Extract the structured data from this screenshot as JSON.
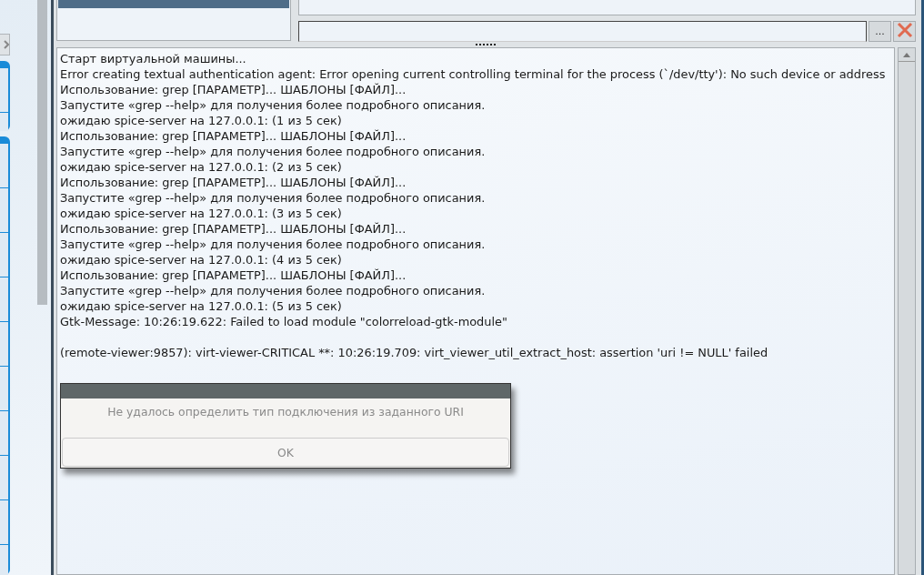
{
  "log": {
    "blocks": [
      [
        "Старт виртуальной машины...",
        "Error creating textual authentication agent: Error opening current controlling terminal for the process (`/dev/tty'): No such device or address",
        "Использование: grep [ПАРАМЕТР]... ШАБЛОНЫ [ФАЙЛ]...",
        "Запустите «grep --help» для получения более подробного описания.",
        "ожидаю spice-server на 127.0.0.1: (1 из 5 сек)",
        "Использование: grep [ПАРАМЕТР]... ШАБЛОНЫ [ФАЙЛ]...",
        "Запустите «grep --help» для получения более подробного описания.",
        "ожидаю spice-server на 127.0.0.1: (2 из 5 сек)",
        "Использование: grep [ПАРАМЕТР]... ШАБЛОНЫ [ФАЙЛ]...",
        "Запустите «grep --help» для получения более подробного описания.",
        "ожидаю spice-server на 127.0.0.1: (3 из 5 сек)",
        "Использование: grep [ПАРАМЕТР]... ШАБЛОНЫ [ФАЙЛ]...",
        "Запустите «grep --help» для получения более подробного описания.",
        "ожидаю spice-server на 127.0.0.1: (4 из 5 сек)",
        "Использование: grep [ПАРАМЕТР]... ШАБЛОНЫ [ФАЙЛ]...",
        "Запустите «grep --help» для получения более подробного описания.",
        "ожидаю spice-server на 127.0.0.1: (5 из 5 сек)",
        "Gtk-Message: 10:26:19.622: Failed to load module \"colorreload-gtk-module\""
      ],
      [
        "(remote-viewer:9857): virt-viewer-CRITICAL **: 10:26:19.709: virt_viewer_util_extract_host: assertion 'uri != NULL' failed"
      ]
    ]
  },
  "path_bar": {
    "browse_button": "..."
  },
  "dialog": {
    "message": "Не удалось определить тип подключения из заданного URI",
    "button": "OK"
  }
}
